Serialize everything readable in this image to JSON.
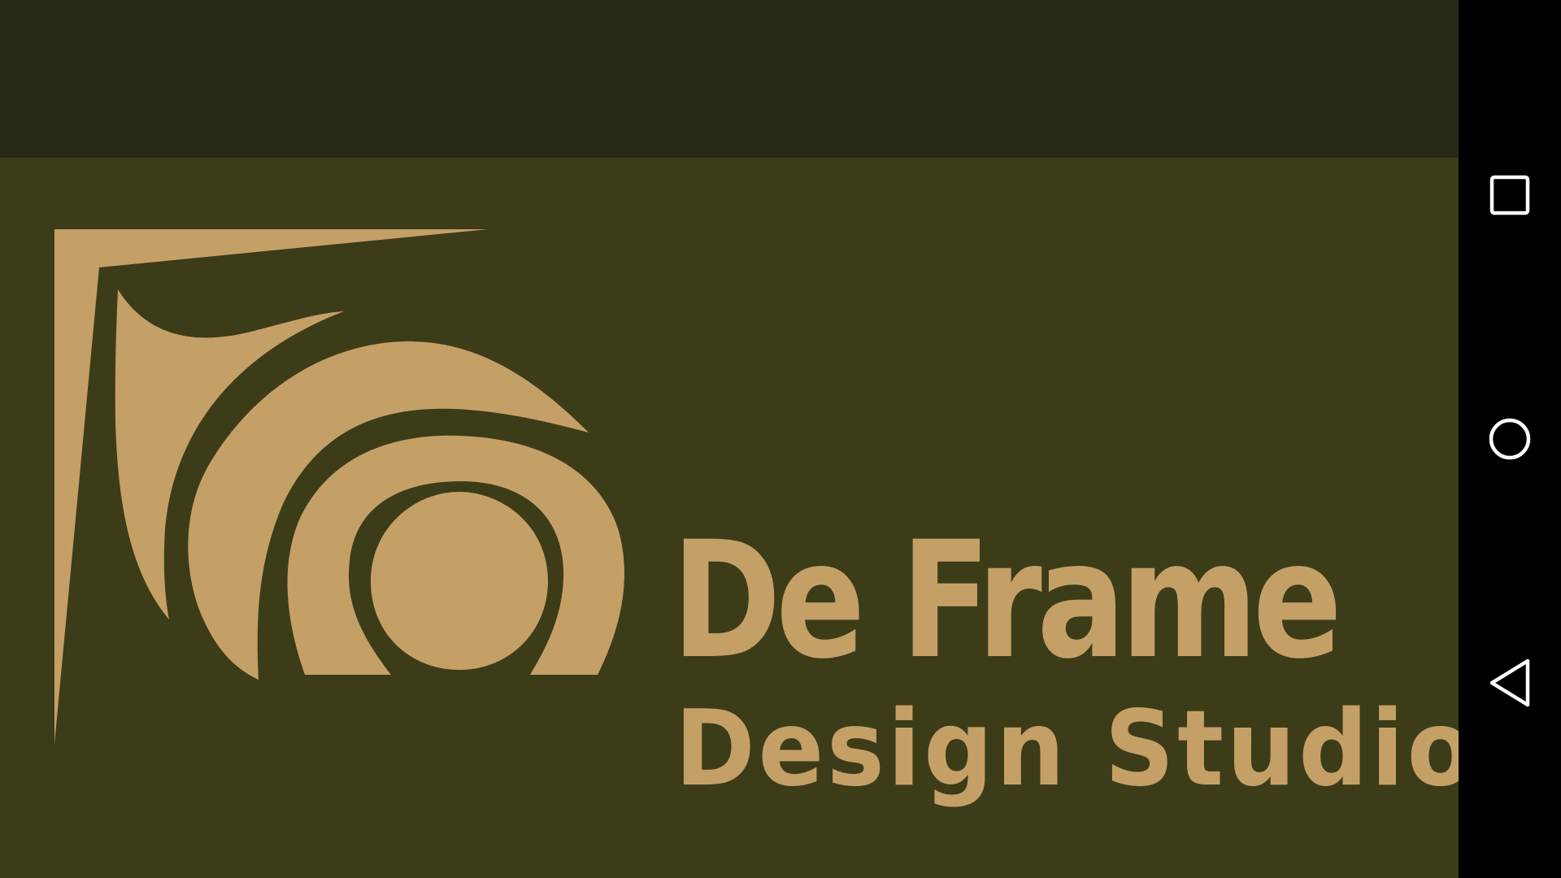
{
  "logo": {
    "name": "De Frame",
    "tagline": "Design Studio"
  },
  "nav_bar": {
    "buttons": [
      {
        "icon": "recents-square-icon"
      },
      {
        "icon": "home-circle-icon"
      },
      {
        "icon": "back-triangle-icon"
      }
    ]
  },
  "colors": {
    "background": "#3d3c19",
    "status_band": "#282915",
    "logo_gold": "#c4a067",
    "nav_bar": "#000000",
    "nav_icon": "#ffffff"
  }
}
